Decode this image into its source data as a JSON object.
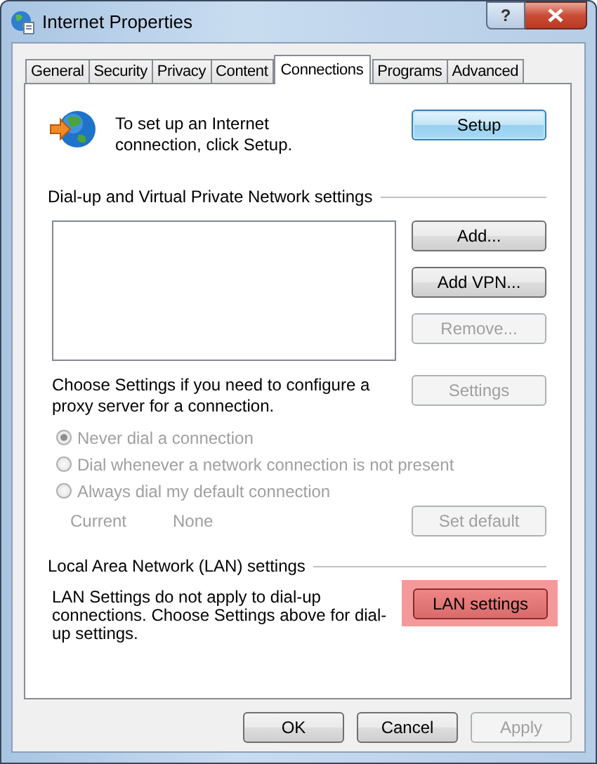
{
  "window": {
    "title": "Internet Properties",
    "help_button": "?"
  },
  "tabs": [
    {
      "label": "General",
      "selected": false
    },
    {
      "label": "Security",
      "selected": false
    },
    {
      "label": "Privacy",
      "selected": false
    },
    {
      "label": "Content",
      "selected": false
    },
    {
      "label": "Connections",
      "selected": true
    },
    {
      "label": "Programs",
      "selected": false
    },
    {
      "label": "Advanced",
      "selected": false
    }
  ],
  "setup": {
    "text": "To set up an Internet connection, click Setup.",
    "button": {
      "label": "Setup",
      "disabled": false,
      "default": true
    }
  },
  "dialup": {
    "heading": "Dial-up and Virtual Private Network settings",
    "buttons": [
      {
        "label": "Add...",
        "disabled": false
      },
      {
        "label": "Add VPN...",
        "disabled": false
      },
      {
        "label": "Remove...",
        "disabled": true
      }
    ]
  },
  "proxy": {
    "text": "Choose Settings if you need to configure a proxy server for a connection.",
    "button": {
      "label": "Settings",
      "disabled": true
    }
  },
  "dial_options": [
    {
      "label": "Never dial a connection",
      "selected": true,
      "disabled": true
    },
    {
      "label": "Dial whenever a network connection is not present",
      "selected": false,
      "disabled": true
    },
    {
      "label": "Always dial my default connection",
      "selected": false,
      "disabled": true
    }
  ],
  "current": {
    "label": "Current",
    "value": "None",
    "disabled": true,
    "button": {
      "label": "Set default",
      "disabled": true
    }
  },
  "lan": {
    "heading": "Local Area Network (LAN) settings",
    "text": "LAN Settings do not apply to dial-up connections. Choose Settings above for dial-up settings.",
    "button": {
      "label": "LAN settings",
      "disabled": false,
      "highlighted": true
    }
  },
  "footer_buttons": [
    {
      "label": "OK",
      "disabled": false
    },
    {
      "label": "Cancel",
      "disabled": false
    },
    {
      "label": "Apply",
      "disabled": true
    }
  ]
}
